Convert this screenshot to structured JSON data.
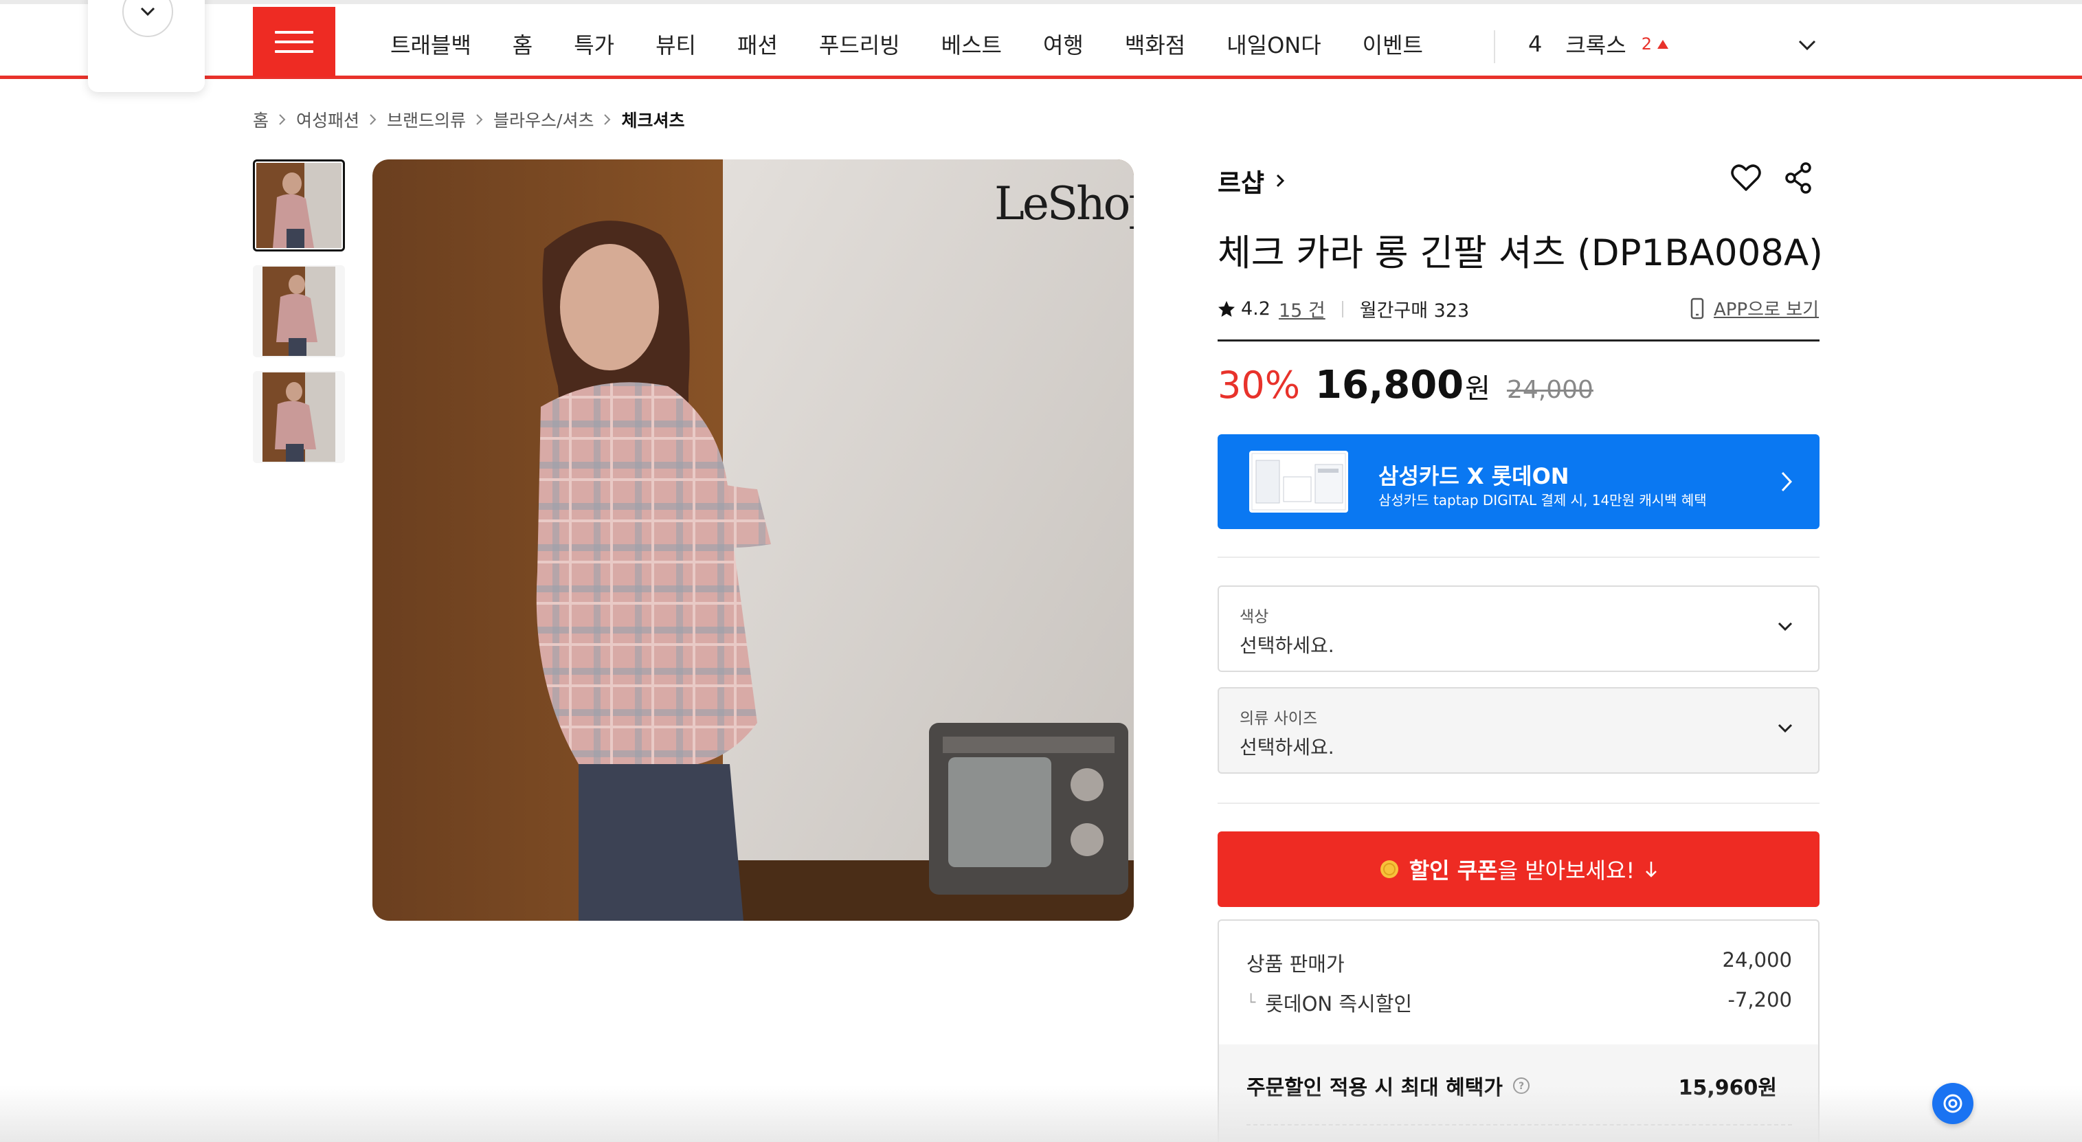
{
  "header": {
    "nav_items": [
      "트래블백",
      "홈",
      "특가",
      "뷰티",
      "패션",
      "푸드리빙",
      "베스트",
      "여행",
      "백화점",
      "내일ON다",
      "이벤트"
    ],
    "rank": {
      "number": "4",
      "keyword": "크록스",
      "change": "2"
    }
  },
  "breadcrumb": [
    "홈",
    "여성패션",
    "브랜드의류",
    "블라우스/셔츠",
    "체크셔츠"
  ],
  "gallery": {
    "logo_text": "LeShop",
    "thumb_count": 3
  },
  "product": {
    "brand": "르샵",
    "title": "체크 카라 롱 긴팔 셔츠 (DP1BA008A)",
    "rating": "4.2",
    "review_count": "15 건",
    "monthly_purchase": "월간구매 323",
    "app_link": "APP으로 보기",
    "discount_rate": "30%",
    "price": "16,800",
    "currency": "원",
    "original_price": "24,000"
  },
  "card_banner": {
    "title": "삼성카드 X 롯데ON",
    "description": "삼성카드 taptap DIGITAL 결제 시, 14만원 캐시백 혜택",
    "bg_color": "#0a78f2"
  },
  "options": [
    {
      "label": "색상",
      "placeholder": "선택하세요."
    },
    {
      "label": "의류 사이즈",
      "placeholder": "선택하세요."
    }
  ],
  "coupon": {
    "bold_text": "할인 쿠폰",
    "rest_text": "을 받아보세요!",
    "bg_color": "#ee2b23"
  },
  "price_breakdown": {
    "sale_price_label": "상품 판매가",
    "sale_price_value": "24,000",
    "instant_discount_label": "롯데ON 즉시할인",
    "instant_discount_value": "-7,200",
    "max_benefit_label": "주문할인 적용 시 최대 혜택가",
    "max_benefit_value": "15,960원"
  },
  "colors": {
    "accent_red": "#ee2b23",
    "discount_red": "#e8322b",
    "fab_blue": "#1a73f2"
  }
}
